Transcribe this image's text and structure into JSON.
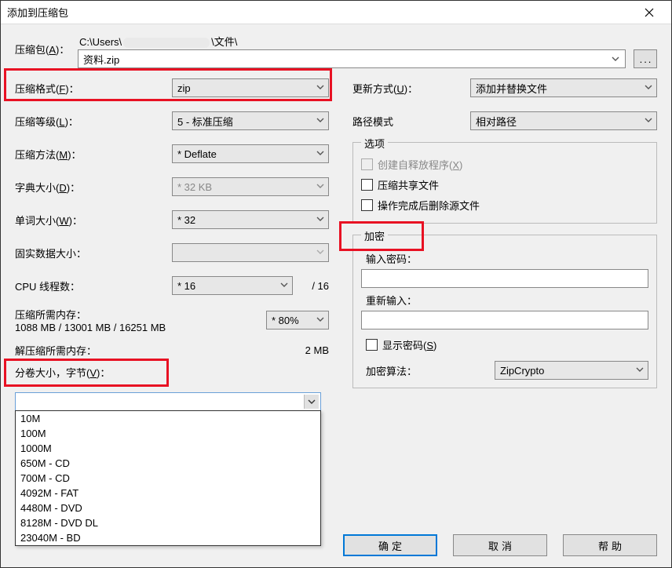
{
  "window": {
    "title": "添加到压缩包"
  },
  "archive": {
    "label_pre": "压缩包(",
    "label_hot": "A",
    "label_post": ")：",
    "path_pre": "C:\\Users\\",
    "path_post": "\\文件\\",
    "filename": "资料.zip"
  },
  "left": {
    "format": {
      "label_pre": "压缩格式(",
      "label_hot": "F",
      "label_post": ")：",
      "value": "zip"
    },
    "level": {
      "label_pre": "压缩等级(",
      "label_hot": "L",
      "label_post": ")：",
      "value": "5 - 标准压缩"
    },
    "method": {
      "label_pre": "压缩方法(",
      "label_hot": "M",
      "label_post": ")：",
      "value": "* Deflate"
    },
    "dict": {
      "label_pre": "字典大小(",
      "label_hot": "D",
      "label_post": ")：",
      "value": "* 32 KB"
    },
    "word": {
      "label_pre": "单词大小(",
      "label_hot": "W",
      "label_post": ")：",
      "value": "* 32"
    },
    "solid": {
      "label": "固实数据大小：",
      "value": ""
    },
    "cpu": {
      "label": "CPU 线程数：",
      "value": "* 16",
      "total": "/ 16"
    },
    "mem_compress_label": "压缩所需内存：",
    "mem_compress_value": "1088 MB / 13001 MB / 16251 MB",
    "mem_percent": "* 80%",
    "mem_decompress_label": "解压缩所需内存：",
    "mem_decompress_value": "2 MB",
    "split": {
      "label_pre": "分卷大小，字节(",
      "label_hot": "V",
      "label_post": ")：",
      "options": [
        "10M",
        "100M",
        "1000M",
        "650M - CD",
        "700M - CD",
        "4092M - FAT",
        "4480M - DVD",
        "8128M - DVD DL",
        "23040M - BD"
      ]
    }
  },
  "right": {
    "update": {
      "label_pre": "更新方式(",
      "label_hot": "U",
      "label_post": ")：",
      "value": "添加并替换文件"
    },
    "path": {
      "label": "路径模式",
      "value": "相对路径"
    },
    "options": {
      "legend": "选项",
      "sfx": {
        "label_pre": "创建自释放程序(",
        "label_hot": "X",
        "label_post": ")"
      },
      "shared": {
        "label": "压缩共享文件"
      },
      "delete": {
        "label": "操作完成后删除源文件"
      }
    },
    "encrypt": {
      "legend": "加密",
      "pwd1_label": "输入密码：",
      "pwd2_label": "重新输入：",
      "show": {
        "label_pre": "显示密码(",
        "label_hot": "S",
        "label_post": ")"
      },
      "algo_label": "加密算法：",
      "algo_value": "ZipCrypto"
    }
  },
  "buttons": {
    "ok": "确定",
    "cancel": "取消",
    "help": "帮助"
  }
}
